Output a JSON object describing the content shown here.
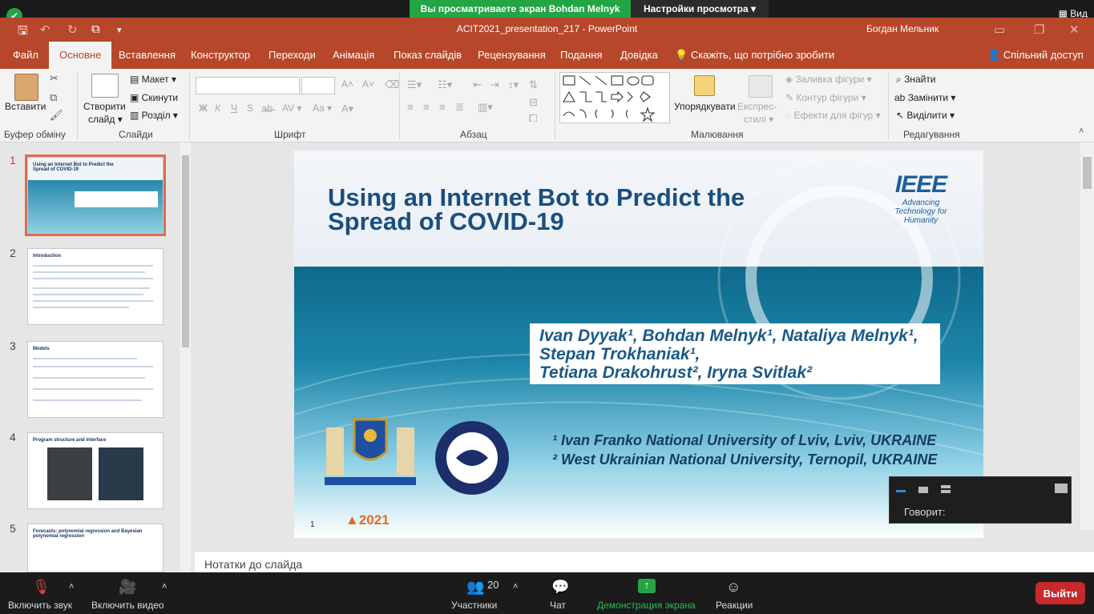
{
  "zoom": {
    "share_indicator": "Вы просматриваете экран Bohdan Melnyk",
    "view_options": "Настройки просмотра ▾",
    "view_label": "Вид",
    "participants_count": "20",
    "buttons": {
      "mute": "Включить звук",
      "video": "Включить видео",
      "participants": "Участники",
      "chat": "Чат",
      "share": "Демонстрация экрана",
      "reactions": "Реакции",
      "leave": "Выйти"
    },
    "speaking_label": "Говорит:"
  },
  "app": {
    "title": "ACIT2021_presentation_217  -  PowerPoint",
    "user": "Богдан Мельник"
  },
  "tabs": [
    "Файл",
    "Основне",
    "Вставлення",
    "Конструктор",
    "Переходи",
    "Анімація",
    "Показ слайдів",
    "Рецензування",
    "Подання",
    "Довідка"
  ],
  "active_tab": "Основне",
  "tell_me": "Скажіть, що потрібно зробити",
  "share": "Спільний доступ",
  "ribbon": {
    "clipboard": {
      "paste": "Вставити",
      "label": "Буфер обміну"
    },
    "slides": {
      "new_slide": "Створити",
      "new_slide2": "слайд ▾",
      "layout": "Макет ▾",
      "reset": "Скинути",
      "section": "Розділ ▾",
      "label": "Слайди"
    },
    "font": {
      "label": "Шрифт",
      "bold": "Ж",
      "italic": "К",
      "underline": "Ч",
      "strike": "S",
      "spacing": "AV ▾",
      "case": "Aa ▾",
      "grow": "A˄",
      "shrink": "A˅"
    },
    "paragraph": {
      "label": "Абзац"
    },
    "drawing": {
      "arrange": "Упорядкувати",
      "styles": "Експрес-",
      "styles2": "стилі ▾",
      "fill": "Заливка фігури ▾",
      "outline": "Контур фігури ▾",
      "effects": "Ефекти для фігур ▾",
      "label": "Малювання"
    },
    "editing": {
      "find": "Знайти",
      "replace": "Замінити ▾",
      "select": "Виділити ▾",
      "label": "Редагування"
    }
  },
  "thumbnails": [
    {
      "num": "1",
      "title": "Using an Internet Bot to Predict the Spread of COVID-19"
    },
    {
      "num": "2",
      "title": "Introduction"
    },
    {
      "num": "3",
      "title": "Models"
    },
    {
      "num": "4",
      "title": "Program structure and interface"
    },
    {
      "num": "5",
      "title": "Forecasts: polynomial regression and Bayesian polynomial regression"
    }
  ],
  "slide": {
    "title": "Using an Internet Bot to Predict the Spread of COVID-19",
    "ieee": "IEEE",
    "ieee_tag": "Advancing Technology for Humanity",
    "authors_line1": "Ivan Dyyak¹, Bohdan Melnyk¹, Nataliya Melnyk¹,",
    "authors_line2": "Stepan Trokhaniak¹,",
    "authors_line3": "Tetiana Drakohrust², Iryna Svitlak²",
    "aff1": "¹ Ivan Franko National University of Lviv, Lviv, UKRAINE",
    "aff2": "² West Ukrainian National University, Ternopil, UKRAINE",
    "slide_number": "1",
    "conf_logo": "2021"
  },
  "notes_placeholder": "Нотатки до слайда",
  "colors": {
    "ppt_accent": "#b7472a",
    "zoom_green": "#23a445",
    "zoom_red": "#c8292c"
  }
}
